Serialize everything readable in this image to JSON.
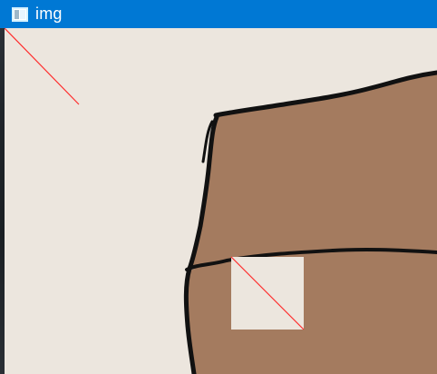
{
  "window": {
    "title": "img",
    "icon": "image-window-icon"
  },
  "image": {
    "background_color": "#ece6de",
    "object_fill_color": "#a47b5f",
    "outline_color": "#111111",
    "selection_fill_color": "#ece6de",
    "marker_color": "#ff2b2b"
  }
}
